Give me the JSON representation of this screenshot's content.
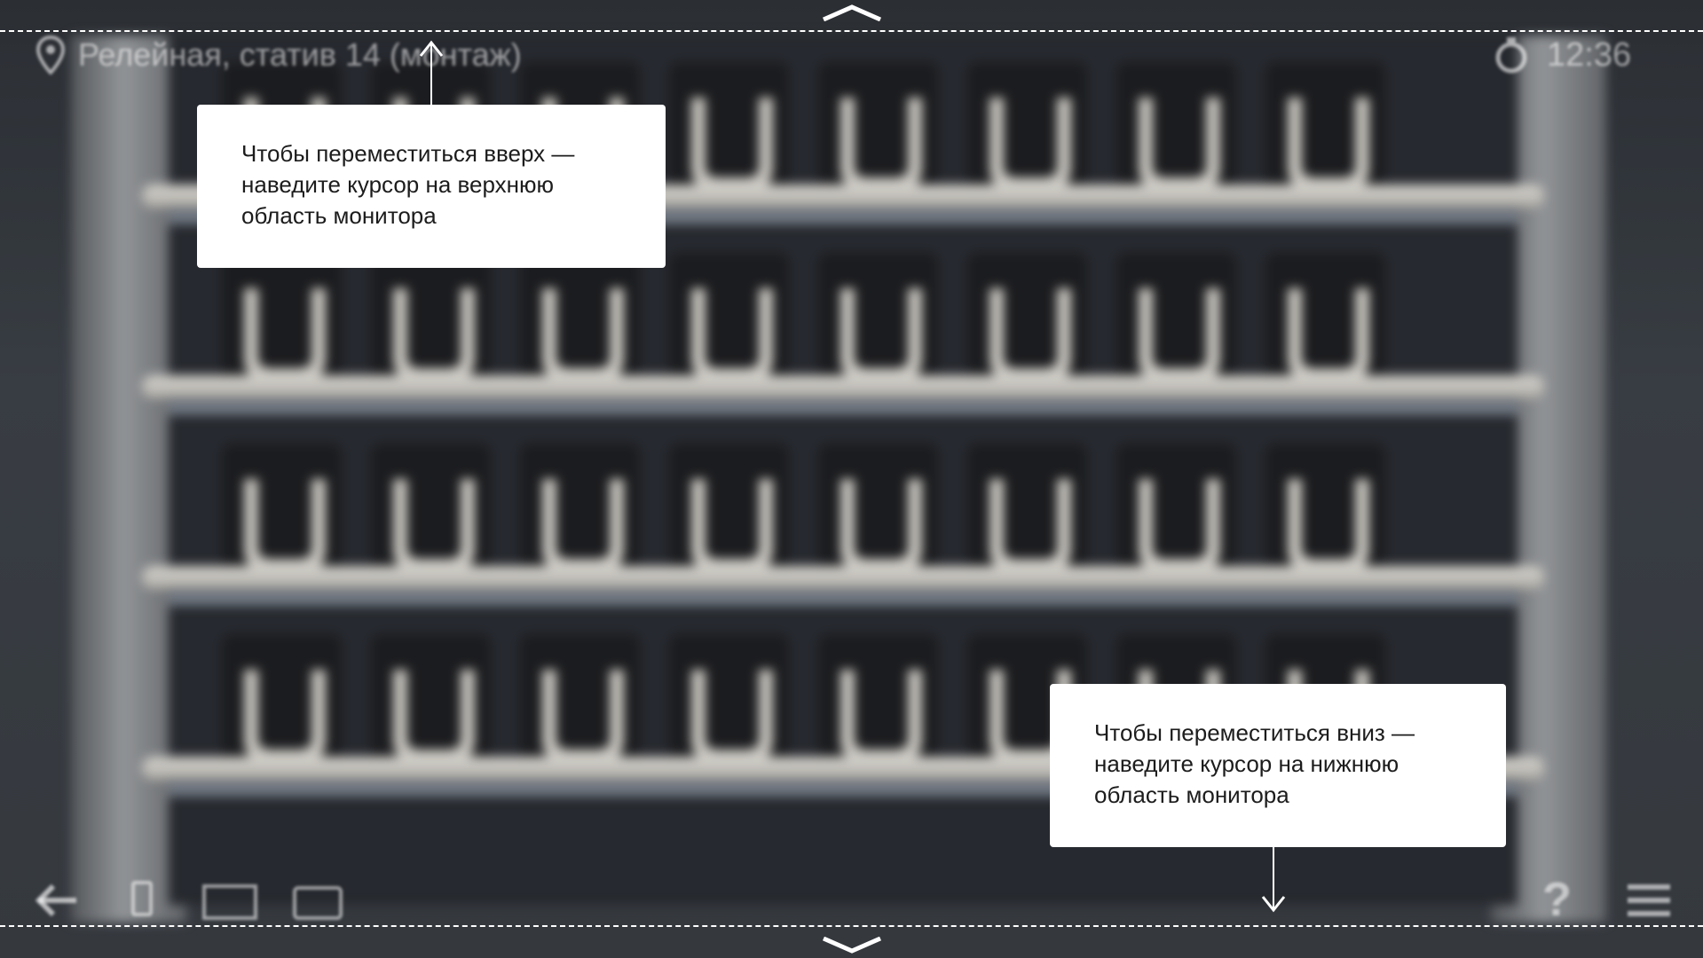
{
  "location": {
    "label": "Релейная, статив 14 (монтаж)",
    "icon": "location-pin-icon"
  },
  "clock": {
    "time": "12:36",
    "icon": "timer-icon"
  },
  "tooltips": {
    "up": "Чтобы переместиться вверх —\nнаведите курсор на верхнюю\nобласть монитора",
    "down": "Чтобы переместиться вниз —\nнаведите курсор на нижнюю\nобласть монитора"
  },
  "toolbar": {
    "back_icon": "back-arrow-icon",
    "tool_icons": [
      "lantern-icon",
      "map-icon",
      "camera-icon"
    ],
    "help_label": "?",
    "menu_icon": "menu-icon"
  },
  "navigation": {
    "up_icon": "chevron-up-icon",
    "down_icon": "chevron-down-icon"
  },
  "colors": {
    "tooltip_bg": "#ffffff",
    "guide_line": "#ffffff",
    "text": "#1c1c1c"
  }
}
